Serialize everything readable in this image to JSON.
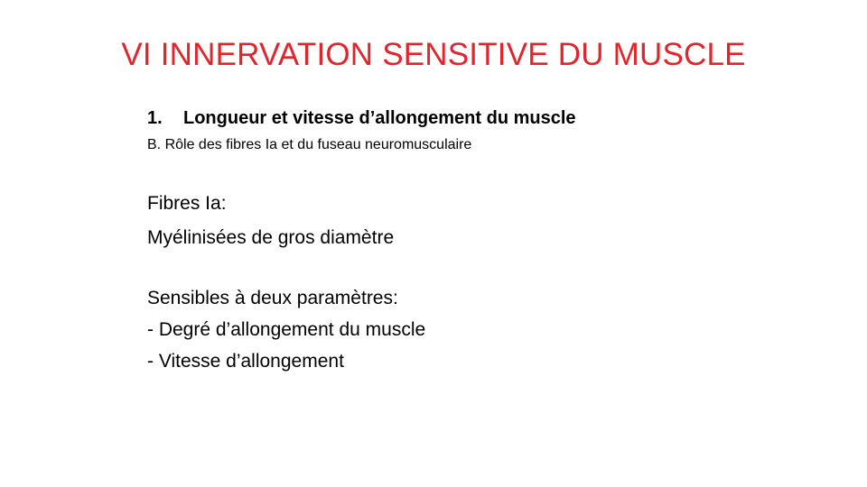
{
  "slide": {
    "title": "VI INNERVATION SENSITIVE DU MUSCLE",
    "heading_number": "1.",
    "heading_text": "Longueur et vitesse d’allongement du muscle",
    "subheading": "B. Rôle des fibres Ia et du fuseau neuromusculaire",
    "lines": [
      "Fibres Ia:",
      "Myélinisées de gros diamètre",
      "Sensibles à deux paramètres:",
      "- Degré d’allongement du muscle",
      "- Vitesse d’allongement"
    ],
    "title_color": "#e0262d"
  }
}
